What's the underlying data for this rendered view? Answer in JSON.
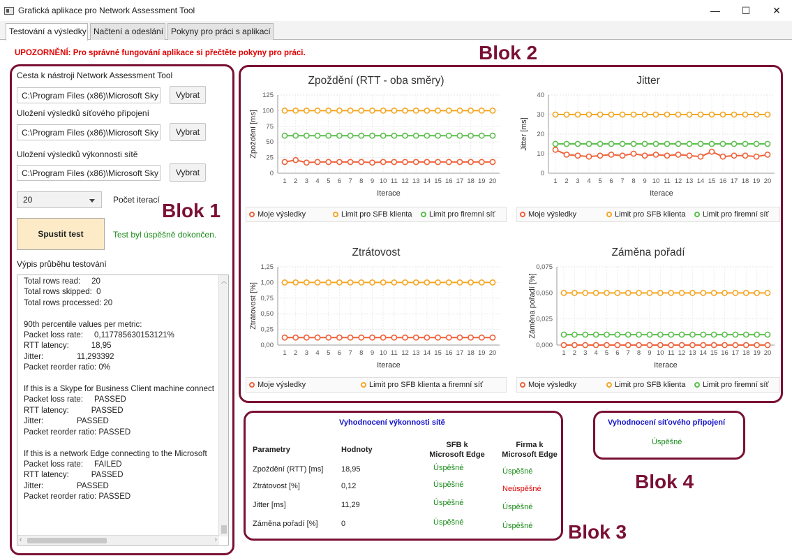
{
  "window": {
    "title": "Grafická aplikace pro Network Assessment Tool",
    "minimize": "—",
    "maximize": "☐",
    "close": "✕"
  },
  "tabs": [
    {
      "label": "Testování a výsledky",
      "active": true
    },
    {
      "label": "Načtení a odeslání",
      "active": false
    },
    {
      "label": "Pokyny pro práci s aplikací",
      "active": false
    }
  ],
  "warning": "UPOZORNĚNÍ: Pro správné fungování aplikace si přečtěte pokyny pro práci.",
  "block_labels": {
    "b1": "Blok 1",
    "b2": "Blok 2",
    "b3": "Blok 3",
    "b4": "Blok 4"
  },
  "settings": {
    "tool_path_label": "Cesta k nástroji Network Assessment Tool",
    "tool_path_value": "C:\\Program Files (x86)\\Microsoft Sky",
    "connectivity_label": "Uložení výsledků síťového připojení",
    "connectivity_value": "C:\\Program Files (x86)\\Microsoft Sky",
    "performance_label": "Uložení výsledků výkonnosti sítě",
    "performance_value": "C:\\Program Files (x86)\\Microsoft Sky",
    "browse_label": "Vybrat",
    "iterations_value": "20",
    "iterations_label": "Počet iterací",
    "start_label": "Spustit test",
    "status": "Test byl úspěšně dokončen.",
    "log_label": "Výpis průběhu testování"
  },
  "log_lines": [
    "Total rows read:     20",
    "Total rows skipped:  0",
    "Total rows processed: 20",
    "",
    "90th percentile values per metric:",
    "Packet loss rate:     0,117785630153121%",
    "RTT latency:          18,95",
    "Jitter:               11,293392",
    "Packet reorder ratio: 0%",
    "",
    "If this is a Skype for Business Client machine connect",
    "Packet loss rate:     PASSED",
    "RTT latency:          PASSED",
    "Jitter:               PASSED",
    "Packet reorder ratio: PASSED",
    "",
    "If this is a network Edge connecting to the Microsoft",
    "Packet loss rate:     FAILED",
    "RTT latency:          PASSED",
    "Jitter:               PASSED",
    "Packet reorder ratio: PASSED"
  ],
  "colors": {
    "mine": "#f0623a",
    "sfb": "#f5a623",
    "corp": "#5cbf4e",
    "accent": "#7a1035",
    "ok": "#1a8a1a",
    "fail": "#e00000"
  },
  "chart_data": [
    {
      "type": "line",
      "title": "Zpoždění (RTT - oba směry)",
      "xlabel": "Iterace",
      "ylabel": "Zpoždění [ms]",
      "x": [
        1,
        2,
        3,
        4,
        5,
        6,
        7,
        8,
        9,
        10,
        11,
        12,
        13,
        14,
        15,
        16,
        17,
        18,
        19,
        20
      ],
      "ylim": [
        0,
        125
      ],
      "yticks": [
        "0",
        "25",
        "50",
        "75",
        "100",
        "125"
      ],
      "series": [
        {
          "name": "Moje výsledky",
          "color": "#f0623a",
          "values": [
            18,
            21,
            17,
            18,
            18,
            18,
            18,
            18,
            17,
            18,
            18,
            18,
            18,
            18,
            18,
            18,
            18,
            18,
            18,
            18
          ]
        },
        {
          "name": "Limit pro SFB klienta",
          "color": "#f5a623",
          "values": [
            100,
            100,
            100,
            100,
            100,
            100,
            100,
            100,
            100,
            100,
            100,
            100,
            100,
            100,
            100,
            100,
            100,
            100,
            100,
            100
          ]
        },
        {
          "name": "Limit pro firemní síť",
          "color": "#5cbf4e",
          "values": [
            60,
            60,
            60,
            60,
            60,
            60,
            60,
            60,
            60,
            60,
            60,
            60,
            60,
            60,
            60,
            60,
            60,
            60,
            60,
            60
          ]
        }
      ]
    },
    {
      "type": "line",
      "title": "Jitter",
      "xlabel": "Iterace",
      "ylabel": "Jitter [ms]",
      "x": [
        1,
        2,
        3,
        4,
        5,
        6,
        7,
        8,
        9,
        10,
        11,
        12,
        13,
        14,
        15,
        16,
        17,
        18,
        19,
        20
      ],
      "ylim": [
        0,
        40
      ],
      "yticks": [
        "0",
        "10",
        "20",
        "30",
        "40"
      ],
      "series": [
        {
          "name": "Moje výsledky",
          "color": "#f0623a",
          "values": [
            12,
            9.5,
            9,
            8.5,
            9,
            9.5,
            9,
            10,
            9,
            9.5,
            9,
            9.5,
            9,
            8.5,
            11,
            8.5,
            9,
            9,
            8.5,
            9.5
          ]
        },
        {
          "name": "Limit pro SFB klienta",
          "color": "#f5a623",
          "values": [
            30,
            30,
            30,
            30,
            30,
            30,
            30,
            30,
            30,
            30,
            30,
            30,
            30,
            30,
            30,
            30,
            30,
            30,
            30,
            30
          ]
        },
        {
          "name": "Limit pro firemní síť",
          "color": "#5cbf4e",
          "values": [
            15,
            15,
            15,
            15,
            15,
            15,
            15,
            15,
            15,
            15,
            15,
            15,
            15,
            15,
            15,
            15,
            15,
            15,
            15,
            15
          ]
        }
      ]
    },
    {
      "type": "line",
      "title": "Ztrátovost",
      "xlabel": "Iterace",
      "ylabel": "Ztrátovost [%]",
      "x": [
        1,
        2,
        3,
        4,
        5,
        6,
        7,
        8,
        9,
        10,
        11,
        12,
        13,
        14,
        15,
        16,
        17,
        18,
        19,
        20
      ],
      "ylim": [
        0,
        1.25
      ],
      "yticks": [
        "0,00",
        "0,25",
        "0,50",
        "0,75",
        "1,00",
        "1,25"
      ],
      "series": [
        {
          "name": "Moje výsledky",
          "color": "#f0623a",
          "values": [
            0.12,
            0.12,
            0.12,
            0.12,
            0.12,
            0.12,
            0.12,
            0.12,
            0.12,
            0.12,
            0.12,
            0.12,
            0.12,
            0.12,
            0.12,
            0.12,
            0.12,
            0.12,
            0.12,
            0.12
          ]
        },
        {
          "name": "Limit pro SFB klienta a firemní síť",
          "color": "#f5a623",
          "values": [
            1,
            1,
            1,
            1,
            1,
            1,
            1,
            1,
            1,
            1,
            1,
            1,
            1,
            1,
            1,
            1,
            1,
            1,
            1,
            1
          ]
        }
      ]
    },
    {
      "type": "line",
      "title": "Záměna pořadí",
      "xlabel": "Iterace",
      "ylabel": "Záměna pořadí [%]",
      "x": [
        1,
        2,
        3,
        4,
        5,
        6,
        7,
        8,
        9,
        10,
        11,
        12,
        13,
        14,
        15,
        16,
        17,
        18,
        19,
        20
      ],
      "ylim": [
        0,
        0.075
      ],
      "yticks": [
        "0,000",
        "0,025",
        "0,050",
        "0,075"
      ],
      "series": [
        {
          "name": "Moje výsledky",
          "color": "#f0623a",
          "values": [
            0,
            0,
            0,
            0,
            0,
            0,
            0,
            0,
            0,
            0,
            0,
            0,
            0,
            0,
            0,
            0,
            0,
            0,
            0,
            0
          ]
        },
        {
          "name": "Limit pro SFB klienta",
          "color": "#f5a623",
          "values": [
            0.05,
            0.05,
            0.05,
            0.05,
            0.05,
            0.05,
            0.05,
            0.05,
            0.05,
            0.05,
            0.05,
            0.05,
            0.05,
            0.05,
            0.05,
            0.05,
            0.05,
            0.05,
            0.05,
            0.05
          ]
        },
        {
          "name": "Limit pro firemní síť",
          "color": "#5cbf4e",
          "values": [
            0.01,
            0.01,
            0.01,
            0.01,
            0.01,
            0.01,
            0.01,
            0.01,
            0.01,
            0.01,
            0.01,
            0.01,
            0.01,
            0.01,
            0.01,
            0.01,
            0.01,
            0.01,
            0.01,
            0.01
          ]
        }
      ]
    }
  ],
  "performance_eval": {
    "title": "Vyhodnocení výkonnosti sítě",
    "headers": [
      "Parametry",
      "Hodnoty",
      "SFB k\nMicrosoft Edge",
      "Firma k\nMicrosoft Edge"
    ],
    "rows": [
      {
        "param": "Zpoždění (RTT) [ms]",
        "value": "18,95",
        "sfb": "Úspěšné",
        "sfb_ok": true,
        "corp": "Úspěšné",
        "corp_ok": true
      },
      {
        "param": "Ztrátovost [%]",
        "value": "0,12",
        "sfb": "Úspěšné",
        "sfb_ok": true,
        "corp": "Neúspěšné",
        "corp_ok": false
      },
      {
        "param": "Jitter [ms]",
        "value": "11,29",
        "sfb": "Úspěšné",
        "sfb_ok": true,
        "corp": "Úspěšné",
        "corp_ok": true
      },
      {
        "param": "Záměna pořadí [%]",
        "value": "0",
        "sfb": "Úspěšné",
        "sfb_ok": true,
        "corp": "Úspěšné",
        "corp_ok": true
      }
    ]
  },
  "connectivity_eval": {
    "title": "Vyhodnocení síťového připojení",
    "result": "Úspěšné"
  }
}
